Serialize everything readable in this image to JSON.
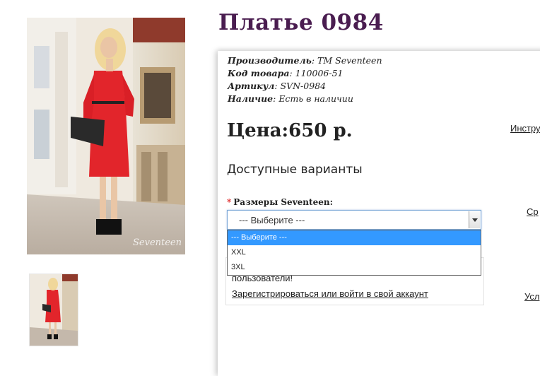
{
  "product": {
    "title": "Платье 0984",
    "meta": [
      {
        "key": "Производитель",
        "value": "TM Seventeen"
      },
      {
        "key": "Код товара",
        "value": "110006-51"
      },
      {
        "key": "Артикул",
        "value": "SVN-0984"
      },
      {
        "key": "Наличие",
        "value": "Есть в наличии"
      }
    ],
    "price": "Цена:650 р."
  },
  "variants": {
    "heading": "Доступные варианты",
    "required_mark": "*",
    "size_label": "Размеры Seventeen:",
    "selected_value": "--- Выберите ---",
    "options": [
      "--- Выберите ---",
      "XXL",
      "3XL"
    ]
  },
  "login": {
    "text": "пользователи!",
    "link": "Зарегистрироваться или войти в свой аккаунт"
  },
  "side_links": {
    "instructions": "Инстру",
    "link2": "Ср",
    "link3": "Усл"
  },
  "images": {
    "watermark": "Seventeen"
  },
  "colors": {
    "title": "#4a1d50",
    "dress": "#e2252b",
    "option_selected": "#3399ff"
  }
}
